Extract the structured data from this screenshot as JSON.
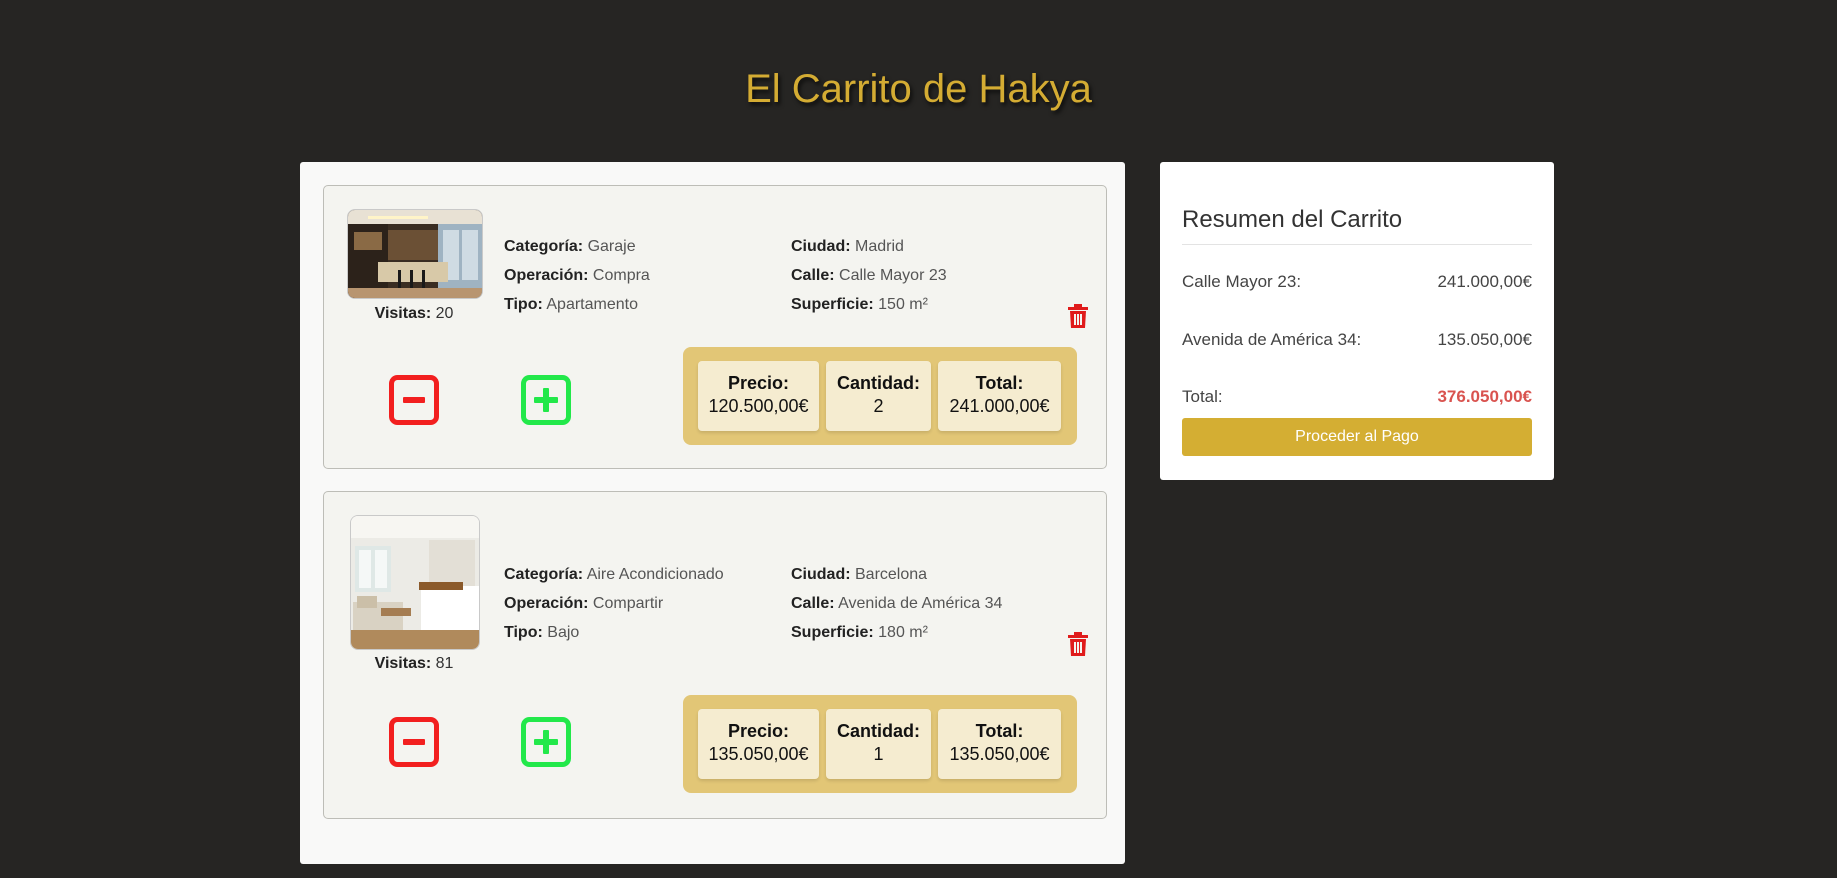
{
  "page": {
    "title": "El Carrito de Hakya"
  },
  "labels": {
    "visits": "Visitas:",
    "category": "Categoría:",
    "operation": "Operación:",
    "type": "Tipo:",
    "city": "Ciudad:",
    "street": "Calle:",
    "surface": "Superficie:",
    "price": "Precio:",
    "quantity": "Cantidad:",
    "total": "Total:"
  },
  "cart": {
    "items": [
      {
        "visits": "20",
        "category": "Garaje",
        "operation": "Compra",
        "type": "Apartamento",
        "city": "Madrid",
        "street": "Calle Mayor 23",
        "surface": "150 m²",
        "price": "120.500,00€",
        "quantity": "2",
        "total": "241.000,00€",
        "image": "kitchen-photo"
      },
      {
        "visits": "81",
        "category": "Aire Acondicionado",
        "operation": "Compartir",
        "type": "Bajo",
        "city": "Barcelona",
        "street": "Avenida de América 34",
        "surface": "180 m²",
        "price": "135.050,00€",
        "quantity": "1",
        "total": "135.050,00€",
        "image": "living-room-photo"
      }
    ]
  },
  "summary": {
    "title": "Resumen del Carrito",
    "lines": [
      {
        "label": "Calle Mayor 23:",
        "amount": "241.000,00€"
      },
      {
        "label": "Avenida de América 34:",
        "amount": "135.050,00€"
      }
    ],
    "total_label": "Total:",
    "total_amount": "376.050,00€",
    "pay_button": "Proceder al Pago"
  },
  "icons": {
    "trash": "trash-icon",
    "minus": "minus-square-icon",
    "plus": "plus-square-icon"
  },
  "colors": {
    "background": "#262523",
    "title": "#d4ac33",
    "minus": "#f21f1f",
    "plus": "#22e84a",
    "trash": "#e01b1b",
    "price_box": "#e2c676",
    "pay_button": "#d4ae33",
    "total_amount": "#d9534f"
  }
}
